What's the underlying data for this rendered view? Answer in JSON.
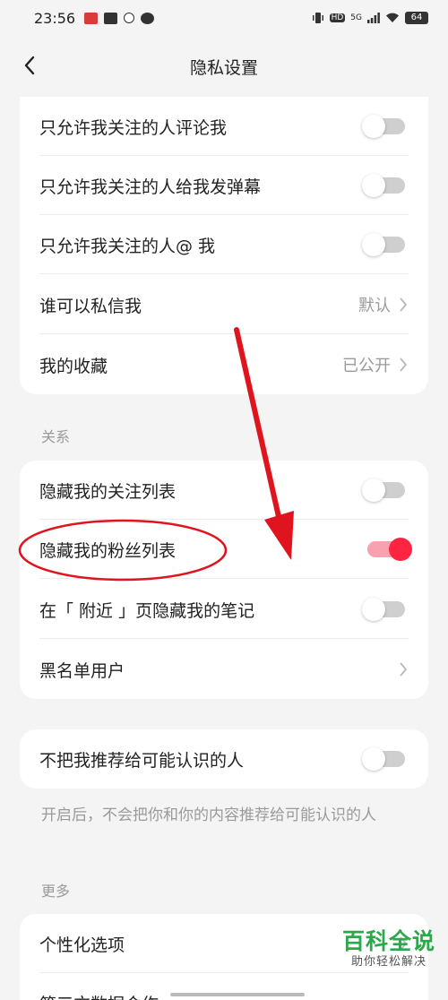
{
  "status": {
    "time": "23:56",
    "network": "5G",
    "hd": "HD",
    "battery": "64"
  },
  "nav": {
    "title": "隐私设置"
  },
  "section1": {
    "rows": [
      {
        "label": "只允许我关注的人评论我",
        "toggle": false
      },
      {
        "label": "只允许我关注的人给我发弹幕",
        "toggle": false
      },
      {
        "label": "只允许我关注的人@ 我",
        "toggle": false
      },
      {
        "label": "谁可以私信我",
        "value": "默认"
      },
      {
        "label": "我的收藏",
        "value": "已公开"
      }
    ]
  },
  "section2": {
    "header": "关系",
    "rows": [
      {
        "label": "隐藏我的关注列表",
        "toggle": false
      },
      {
        "label": "隐藏我的粉丝列表",
        "toggle": true
      },
      {
        "label": "在「 附近 」页隐藏我的笔记",
        "toggle": false
      },
      {
        "label": "黑名单用户"
      }
    ]
  },
  "section3": {
    "rows": [
      {
        "label": "不把我推荐给可能认识的人",
        "toggle": false
      }
    ],
    "hint": "开启后，不会把你和你的内容推荐给可能认识的人"
  },
  "section4": {
    "header": "更多",
    "rows": [
      {
        "label": "个性化选项"
      },
      {
        "label": "第三方数据合作"
      }
    ]
  },
  "watermark": {
    "title": "百科全说",
    "subtitle": "助你轻松解决"
  },
  "colors": {
    "accent": "#ff2442",
    "annotation": "#e0141e",
    "watermark": "#2aa84a"
  }
}
